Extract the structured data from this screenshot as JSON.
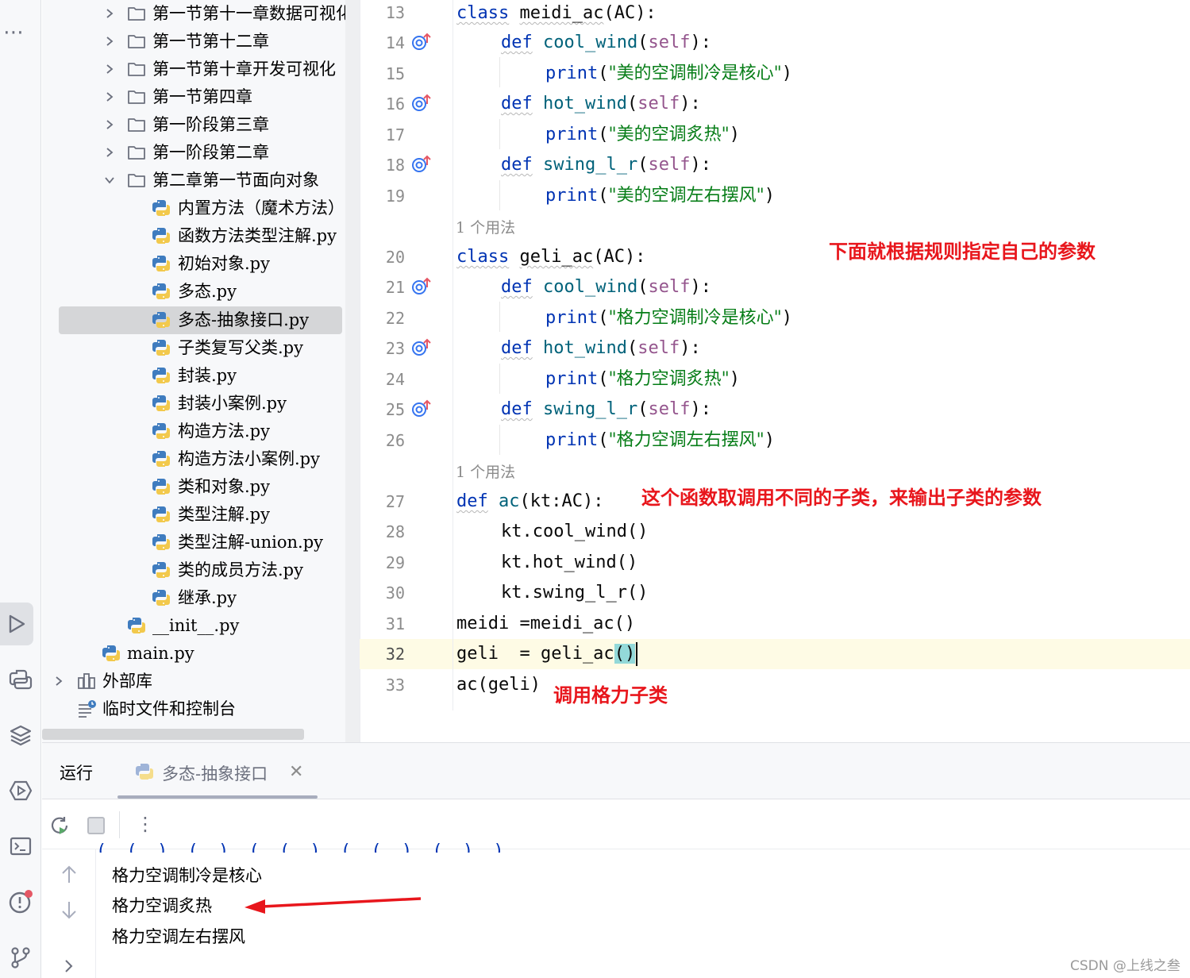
{
  "toolstrip": {
    "more_glyph": "⋯",
    "icons": [
      "run-icon",
      "python-console-icon",
      "layers-icon",
      "services-icon",
      "terminal-icon",
      "problems-icon",
      "git-icon"
    ]
  },
  "project_tree": {
    "rows": [
      {
        "label": "第一节第十一章数据可视化",
        "type": "folder",
        "expanded": false
      },
      {
        "label": "第一节第十二章",
        "type": "folder",
        "expanded": false
      },
      {
        "label": "第一节第十章开发可视化",
        "type": "folder",
        "expanded": false
      },
      {
        "label": "第一节第四章",
        "type": "folder",
        "expanded": false
      },
      {
        "label": "第一阶段第三章",
        "type": "folder",
        "expanded": false
      },
      {
        "label": "第一阶段第二章",
        "type": "folder",
        "expanded": false
      },
      {
        "label": "第二章第一节面向对象",
        "type": "folder",
        "expanded": true
      },
      {
        "label": "内置方法（魔术方法）.",
        "type": "py"
      },
      {
        "label": "函数方法类型注解.py",
        "type": "py"
      },
      {
        "label": "初始对象.py",
        "type": "py"
      },
      {
        "label": "多态.py",
        "type": "py"
      },
      {
        "label": "多态-抽象接口.py",
        "type": "py",
        "selected": true
      },
      {
        "label": "子类复写父类.py",
        "type": "py"
      },
      {
        "label": "封装.py",
        "type": "py"
      },
      {
        "label": "封装小案例.py",
        "type": "py"
      },
      {
        "label": "构造方法.py",
        "type": "py"
      },
      {
        "label": "构造方法小案例.py",
        "type": "py"
      },
      {
        "label": "类和对象.py",
        "type": "py"
      },
      {
        "label": "类型注解.py",
        "type": "py"
      },
      {
        "label": "类型注解-union.py",
        "type": "py"
      },
      {
        "label": "类的成员方法.py",
        "type": "py"
      },
      {
        "label": "继承.py",
        "type": "py"
      },
      {
        "label": "__init__.py",
        "type": "py"
      },
      {
        "label": "main.py",
        "type": "py"
      },
      {
        "label": "外部库",
        "type": "library"
      },
      {
        "label": "临时文件和控制台",
        "type": "scratch"
      }
    ]
  },
  "editor": {
    "line_numbers": [
      "13",
      "14",
      "15",
      "16",
      "17",
      "18",
      "19",
      "20",
      "21",
      "22",
      "23",
      "24",
      "25",
      "26",
      "27",
      "28",
      "29",
      "30",
      "31",
      "32",
      "33"
    ],
    "usage_hint": "1 个用法",
    "code": {
      "l13": {
        "kw": "class",
        "name": "meidi_ac",
        "rest": "(AC):"
      },
      "l14": {
        "kw": "def",
        "name": "cool_wind",
        "self": "self",
        "rest": "):"
      },
      "l15": {
        "fn": "print",
        "open": "(",
        "str": "\"美的空调制冷是核心\"",
        "close": ")"
      },
      "l16": {
        "kw": "def",
        "name": "hot_wind",
        "self": "self",
        "rest": "):"
      },
      "l17": {
        "fn": "print",
        "open": "(",
        "str": "\"美的空调炙热\"",
        "close": ")"
      },
      "l18": {
        "kw": "def",
        "name": "swing_l_r",
        "self": "self",
        "rest": "):"
      },
      "l19": {
        "fn": "print",
        "open": "(",
        "str": "\"美的空调左右摆风\"",
        "close": ")"
      },
      "l20": {
        "kw": "class",
        "name": "geli_ac",
        "rest": "(AC):"
      },
      "l21": {
        "kw": "def",
        "name": "cool_wind",
        "self": "self",
        "rest": "):"
      },
      "l22": {
        "fn": "print",
        "open": "(",
        "str": "\"格力空调制冷是核心\"",
        "close": ")"
      },
      "l23": {
        "kw": "def",
        "name": "hot_wind",
        "self": "self",
        "rest": "):"
      },
      "l24": {
        "fn": "print",
        "open": "(",
        "str": "\"格力空调炙热\"",
        "close": ")"
      },
      "l25": {
        "kw": "def",
        "name": "swing_l_r",
        "self": "self",
        "rest": "):"
      },
      "l26": {
        "fn": "print",
        "open": "(",
        "str": "\"格力空调左右摆风\"",
        "close": ")"
      },
      "l27": {
        "kw": "def",
        "name": "ac",
        "rest": "(kt:AC):"
      },
      "l28": {
        "text": "kt.cool_wind()"
      },
      "l29": {
        "text": "kt.hot_wind()"
      },
      "l30": {
        "text": "kt.swing_l_r()"
      },
      "l31": {
        "text": "meidi =meidi_ac()"
      },
      "l32": {
        "pre": "geli  = geli_ac",
        "open": "(",
        "close": ")"
      },
      "l33": {
        "text": "ac(geli)"
      }
    }
  },
  "annotations": {
    "params": "下面就根据规则指定自己的参数",
    "func": "这个函数取调用不同的子类，来输出子类的参数",
    "call": "调用格力子类"
  },
  "run_panel": {
    "title": "运行",
    "tab_label": "多态-抽象接口",
    "close_glyph": "✕",
    "menu_glyph": "⋮",
    "output": [
      "格力空调制冷是核心",
      "格力空调炙热",
      "格力空调左右摆风"
    ],
    "cut_off_line": "(  (  )  (  )  (  (  )  (  (  )  (  )  )"
  },
  "watermark": "CSDN @上线之叁",
  "colors": {
    "keyword": "#0033b3",
    "function": "#00627a",
    "self": "#94558d",
    "string": "#067d17",
    "annotation": "#e8161c"
  }
}
